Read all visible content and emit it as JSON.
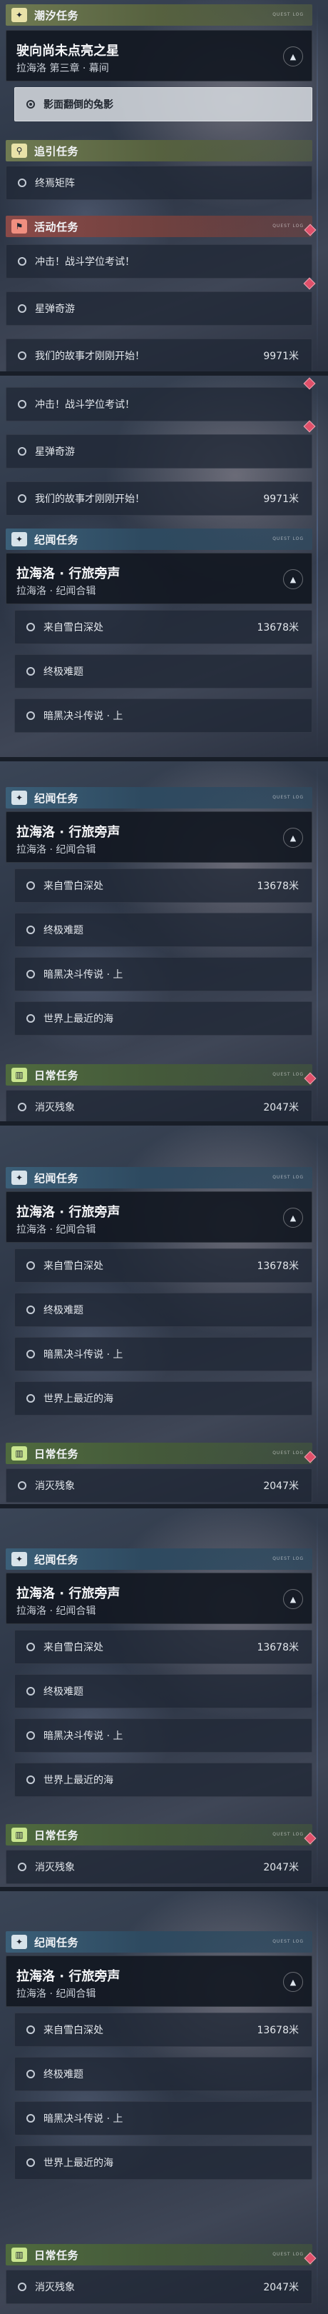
{
  "headers": {
    "tidal": "潮汐任务",
    "guide": "追引任务",
    "event": "活动任务",
    "travel": "纪闻任务",
    "daily": "日常任务"
  },
  "header_tag": "QUEST LOG",
  "tidal_card": {
    "title": "驶向尚未点亮之星",
    "subtitle": "拉海洛 第三章 · 幕间"
  },
  "tidal_step": "影面翻倒的兔影",
  "guide_step": "终焉矩阵",
  "event_items": [
    {
      "label": "冲击！战斗学位考试！",
      "distance": ""
    },
    {
      "label": "星弹奇游",
      "distance": ""
    },
    {
      "label": "我们的故事才刚刚开始！",
      "distance": "9971米"
    }
  ],
  "travel_card": {
    "title": "拉海洛 · 行旅旁声",
    "subtitle": "拉海洛 · 纪闻合辑"
  },
  "travel_items": [
    {
      "label": "来自雪白深处",
      "distance": "13678米"
    },
    {
      "label": "终极难题",
      "distance": ""
    },
    {
      "label": "暗黑决斗传说 · 上",
      "distance": ""
    },
    {
      "label": "世界上最近的海",
      "distance": ""
    }
  ],
  "daily_item": {
    "label": "消灭残象",
    "distance": "2047米"
  },
  "icons": {
    "tidal": "sparkle-icon",
    "guide": "location-pin-icon",
    "event": "event-flag-icon",
    "travel": "sparkle-icon",
    "daily": "book-icon",
    "toggle": "chevron-up-icon",
    "tracked": "alert-diamond-icon"
  }
}
